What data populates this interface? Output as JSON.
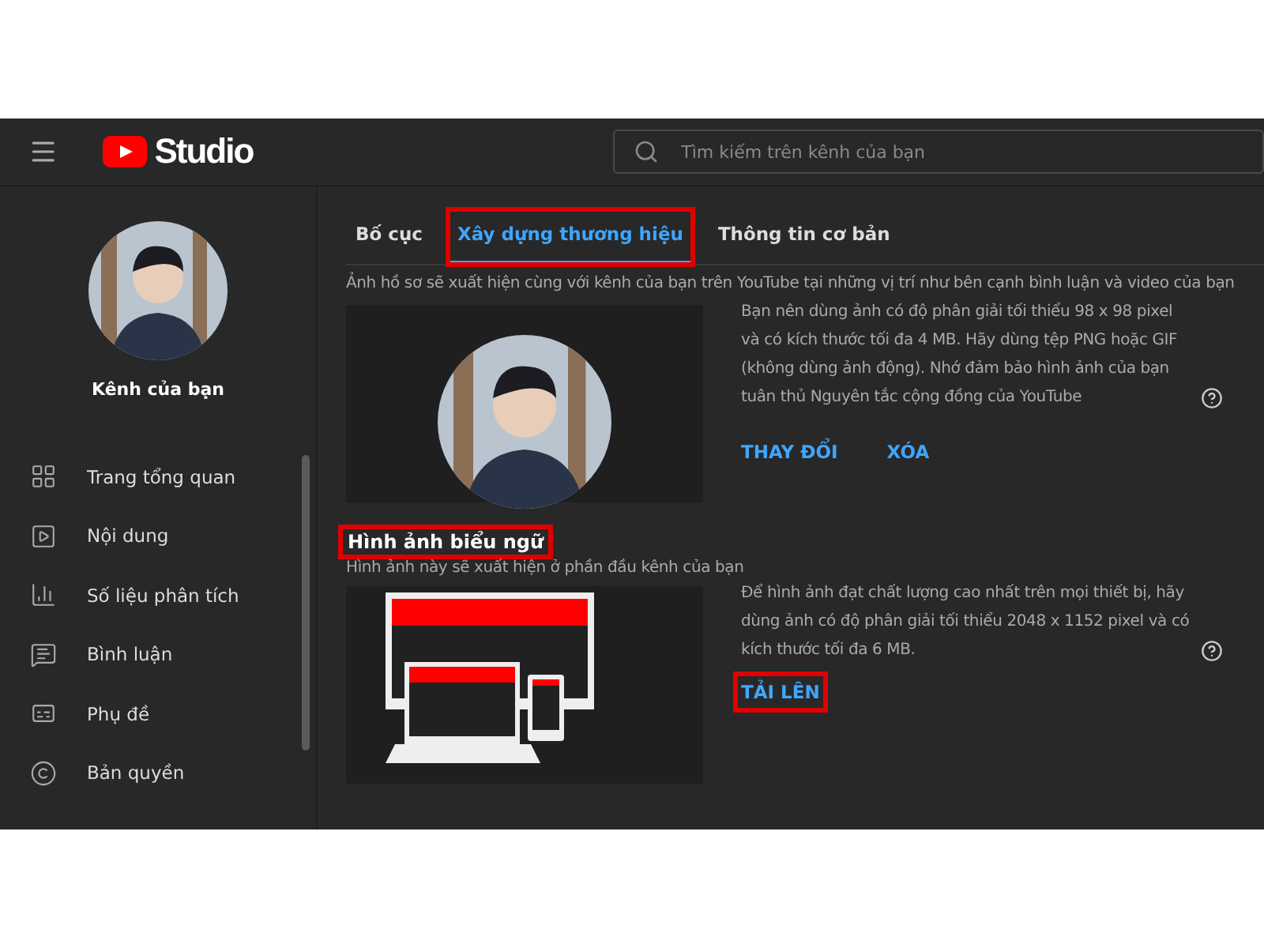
{
  "header": {
    "logo_text": "Studio",
    "search": {
      "placeholder": "Tìm kiếm trên kênh của bạn"
    }
  },
  "sidebar": {
    "channel_title": "Kênh của bạn",
    "items": [
      {
        "label": "Trang tổng quan",
        "selected": false
      },
      {
        "label": "Nội dung",
        "selected": false
      },
      {
        "label": "Số liệu phân tích",
        "selected": false
      },
      {
        "label": "Bình luận",
        "selected": false
      },
      {
        "label": "Phụ đề",
        "selected": false
      },
      {
        "label": "Bản quyền",
        "selected": false
      }
    ]
  },
  "tabs": [
    {
      "label": "Bố cục",
      "selected": false,
      "highlighted": false
    },
    {
      "label": "Xây dựng thương hiệu",
      "selected": true,
      "highlighted": true
    },
    {
      "label": "Thông tin cơ bản",
      "selected": false,
      "highlighted": false
    }
  ],
  "profile_section": {
    "description": "Ảnh hồ sơ sẽ xuất hiện cùng với kênh của bạn trên YouTube tại những vị trí như bên cạnh bình luận và video của bạn",
    "info": "Bạn nên dùng ảnh có độ phân giải tối thiểu 98 x 98 pixel và có kích thước tối đa 4 MB. Hãy dùng tệp PNG hoặc GIF (không dùng ảnh động). Nhớ đảm bảo hình ảnh của bạn tuân thủ Nguyên tắc cộng đồng của YouTube",
    "actions": [
      {
        "label": "THAY ĐỔI",
        "highlighted": false
      },
      {
        "label": "XÓA",
        "highlighted": false
      }
    ]
  },
  "banner_section": {
    "title": "Hình ảnh biểu ngữ",
    "title_highlighted": true,
    "description": "Hình ảnh này sẽ xuất hiện ở phần đầu kênh của bạn",
    "info": "Để hình ảnh đạt chất lượng cao nhất trên mọi thiết bị, hãy dùng ảnh có độ phân giải tối thiểu 2048 x 1152 pixel và có kích thước tối đa 6 MB.",
    "actions": [
      {
        "label": "TẢI LÊN",
        "highlighted": true
      }
    ]
  }
}
